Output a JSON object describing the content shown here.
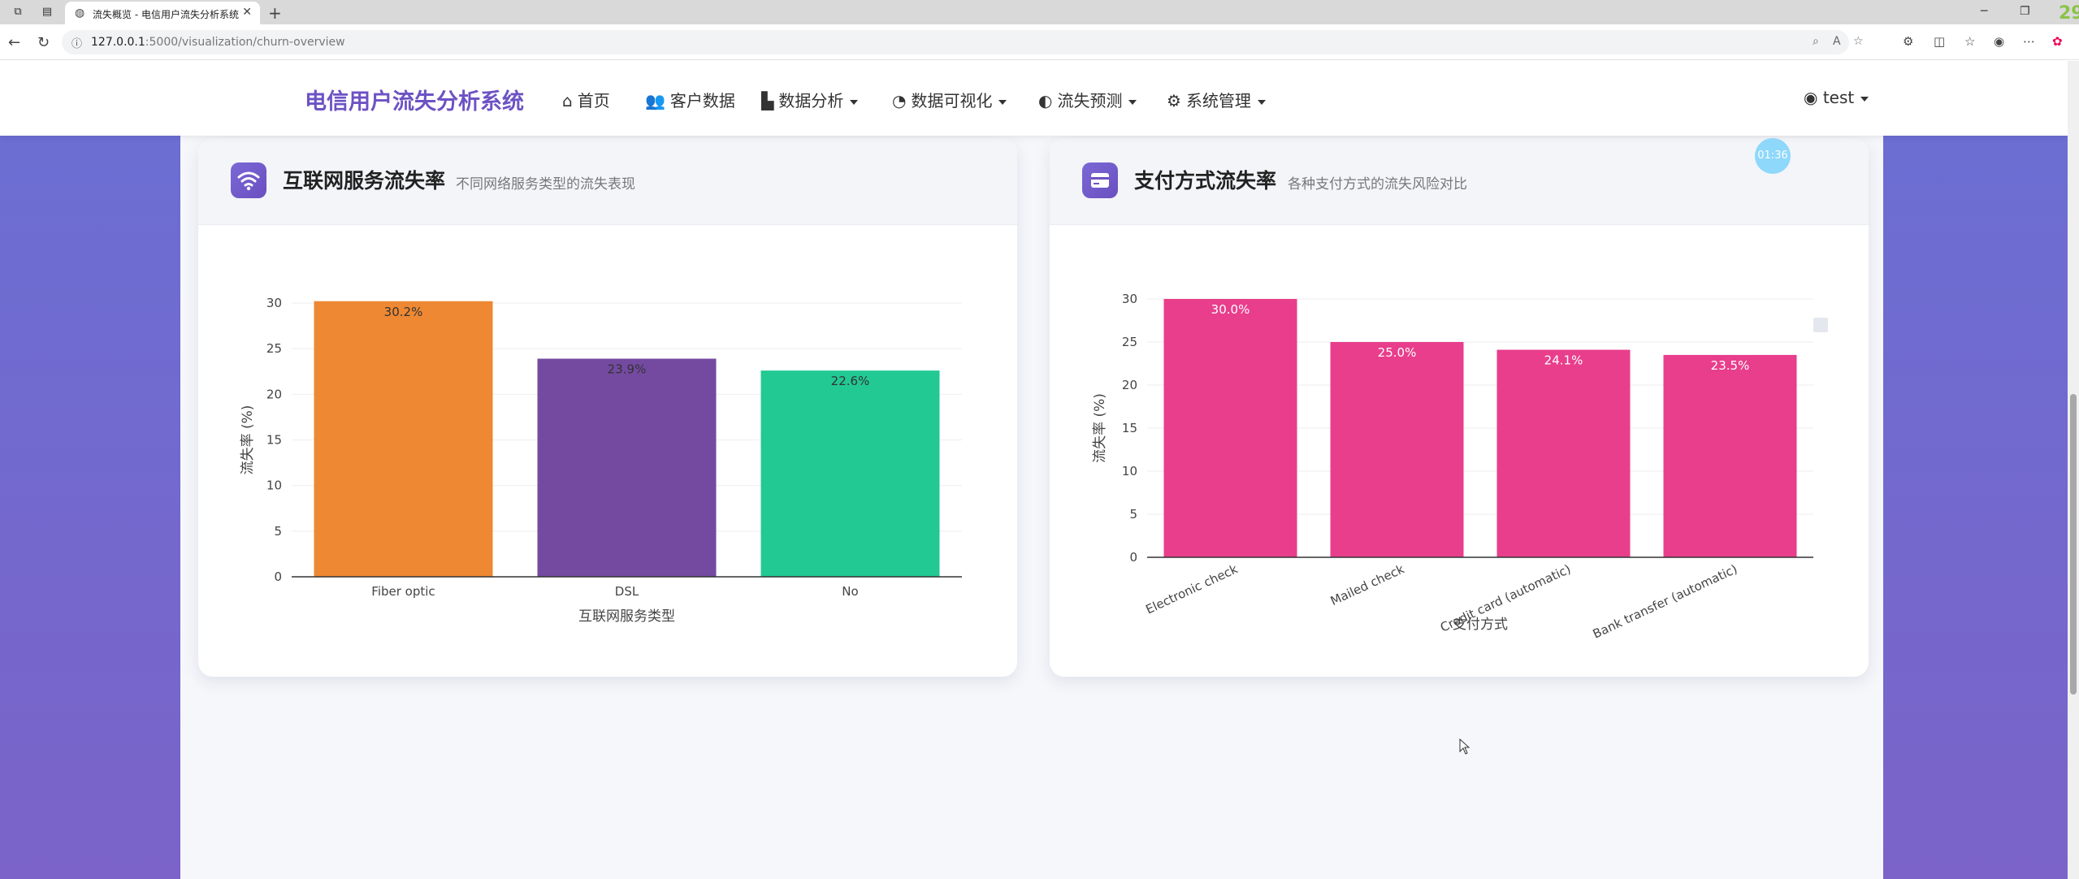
{
  "browser": {
    "tab_title": "流失概览 - 电信用户流失分析系统",
    "url_host": "127.0.0.1",
    "url_path": ":5000/visualization/churn-overview",
    "extension_badge": "29"
  },
  "navbar": {
    "brand": "电信用户流失分析系统",
    "items": [
      {
        "label": "首页",
        "icon": "home-icon",
        "dropdown": false
      },
      {
        "label": "客户数据",
        "icon": "users-icon",
        "dropdown": false
      },
      {
        "label": "数据分析",
        "icon": "chart-bar-icon",
        "dropdown": true
      },
      {
        "label": "数据可视化",
        "icon": "pie-chart-icon",
        "dropdown": true
      },
      {
        "label": "流失预测",
        "icon": "brain-icon",
        "dropdown": true
      },
      {
        "label": "系统管理",
        "icon": "gear-icon",
        "dropdown": true
      }
    ],
    "user": "test"
  },
  "timer": "01:36",
  "cards": {
    "internet": {
      "title": "互联网服务流失率",
      "subtitle": "不同网络服务类型的流失表现",
      "icon": "wifi-icon"
    },
    "payment": {
      "title": "支付方式流失率",
      "subtitle": "各种支付方式的流失风险对比",
      "icon": "credit-card-icon"
    }
  },
  "chart_data": [
    {
      "type": "bar",
      "categories": [
        "Fiber optic",
        "DSL",
        "No"
      ],
      "values": [
        30.2,
        23.9,
        22.6
      ],
      "data_labels": [
        "30.2%",
        "23.9%",
        "22.6%"
      ],
      "colors": [
        "#ee8833",
        "#744aa1",
        "#22c993"
      ],
      "xlabel": "互联网服务类型",
      "ylabel": "流失率 (%)",
      "ylim": [
        0,
        30
      ],
      "yticks": [
        0,
        5,
        10,
        15,
        20,
        25,
        30
      ],
      "grid": true
    },
    {
      "type": "bar",
      "categories": [
        "Electronic check",
        "Mailed check",
        "Credit card (automatic)",
        "Bank transfer (automatic)"
      ],
      "values": [
        30.0,
        25.0,
        24.1,
        23.5
      ],
      "data_labels": [
        "30.0%",
        "25.0%",
        "24.1%",
        "23.5%"
      ],
      "colors": [
        "#e83e8c",
        "#e83e8c",
        "#e83e8c",
        "#e83e8c"
      ],
      "xlabel": "支付方式",
      "ylabel": "流失率 (%)",
      "ylim": [
        0,
        30
      ],
      "yticks": [
        0,
        5,
        10,
        15,
        20,
        25,
        30
      ],
      "grid": true
    }
  ]
}
